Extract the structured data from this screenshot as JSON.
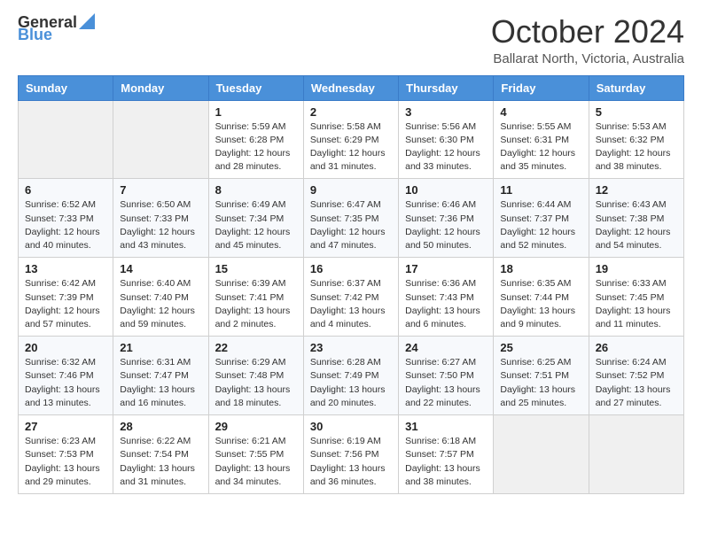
{
  "logo": {
    "general": "General",
    "blue": "Blue"
  },
  "title": "October 2024",
  "location": "Ballarat North, Victoria, Australia",
  "days_of_week": [
    "Sunday",
    "Monday",
    "Tuesday",
    "Wednesday",
    "Thursday",
    "Friday",
    "Saturday"
  ],
  "weeks": [
    [
      {
        "day": "",
        "info": ""
      },
      {
        "day": "",
        "info": ""
      },
      {
        "day": "1",
        "info": "Sunrise: 5:59 AM\nSunset: 6:28 PM\nDaylight: 12 hours\nand 28 minutes."
      },
      {
        "day": "2",
        "info": "Sunrise: 5:58 AM\nSunset: 6:29 PM\nDaylight: 12 hours\nand 31 minutes."
      },
      {
        "day": "3",
        "info": "Sunrise: 5:56 AM\nSunset: 6:30 PM\nDaylight: 12 hours\nand 33 minutes."
      },
      {
        "day": "4",
        "info": "Sunrise: 5:55 AM\nSunset: 6:31 PM\nDaylight: 12 hours\nand 35 minutes."
      },
      {
        "day": "5",
        "info": "Sunrise: 5:53 AM\nSunset: 6:32 PM\nDaylight: 12 hours\nand 38 minutes."
      }
    ],
    [
      {
        "day": "6",
        "info": "Sunrise: 6:52 AM\nSunset: 7:33 PM\nDaylight: 12 hours\nand 40 minutes."
      },
      {
        "day": "7",
        "info": "Sunrise: 6:50 AM\nSunset: 7:33 PM\nDaylight: 12 hours\nand 43 minutes."
      },
      {
        "day": "8",
        "info": "Sunrise: 6:49 AM\nSunset: 7:34 PM\nDaylight: 12 hours\nand 45 minutes."
      },
      {
        "day": "9",
        "info": "Sunrise: 6:47 AM\nSunset: 7:35 PM\nDaylight: 12 hours\nand 47 minutes."
      },
      {
        "day": "10",
        "info": "Sunrise: 6:46 AM\nSunset: 7:36 PM\nDaylight: 12 hours\nand 50 minutes."
      },
      {
        "day": "11",
        "info": "Sunrise: 6:44 AM\nSunset: 7:37 PM\nDaylight: 12 hours\nand 52 minutes."
      },
      {
        "day": "12",
        "info": "Sunrise: 6:43 AM\nSunset: 7:38 PM\nDaylight: 12 hours\nand 54 minutes."
      }
    ],
    [
      {
        "day": "13",
        "info": "Sunrise: 6:42 AM\nSunset: 7:39 PM\nDaylight: 12 hours\nand 57 minutes."
      },
      {
        "day": "14",
        "info": "Sunrise: 6:40 AM\nSunset: 7:40 PM\nDaylight: 12 hours\nand 59 minutes."
      },
      {
        "day": "15",
        "info": "Sunrise: 6:39 AM\nSunset: 7:41 PM\nDaylight: 13 hours\nand 2 minutes."
      },
      {
        "day": "16",
        "info": "Sunrise: 6:37 AM\nSunset: 7:42 PM\nDaylight: 13 hours\nand 4 minutes."
      },
      {
        "day": "17",
        "info": "Sunrise: 6:36 AM\nSunset: 7:43 PM\nDaylight: 13 hours\nand 6 minutes."
      },
      {
        "day": "18",
        "info": "Sunrise: 6:35 AM\nSunset: 7:44 PM\nDaylight: 13 hours\nand 9 minutes."
      },
      {
        "day": "19",
        "info": "Sunrise: 6:33 AM\nSunset: 7:45 PM\nDaylight: 13 hours\nand 11 minutes."
      }
    ],
    [
      {
        "day": "20",
        "info": "Sunrise: 6:32 AM\nSunset: 7:46 PM\nDaylight: 13 hours\nand 13 minutes."
      },
      {
        "day": "21",
        "info": "Sunrise: 6:31 AM\nSunset: 7:47 PM\nDaylight: 13 hours\nand 16 minutes."
      },
      {
        "day": "22",
        "info": "Sunrise: 6:29 AM\nSunset: 7:48 PM\nDaylight: 13 hours\nand 18 minutes."
      },
      {
        "day": "23",
        "info": "Sunrise: 6:28 AM\nSunset: 7:49 PM\nDaylight: 13 hours\nand 20 minutes."
      },
      {
        "day": "24",
        "info": "Sunrise: 6:27 AM\nSunset: 7:50 PM\nDaylight: 13 hours\nand 22 minutes."
      },
      {
        "day": "25",
        "info": "Sunrise: 6:25 AM\nSunset: 7:51 PM\nDaylight: 13 hours\nand 25 minutes."
      },
      {
        "day": "26",
        "info": "Sunrise: 6:24 AM\nSunset: 7:52 PM\nDaylight: 13 hours\nand 27 minutes."
      }
    ],
    [
      {
        "day": "27",
        "info": "Sunrise: 6:23 AM\nSunset: 7:53 PM\nDaylight: 13 hours\nand 29 minutes."
      },
      {
        "day": "28",
        "info": "Sunrise: 6:22 AM\nSunset: 7:54 PM\nDaylight: 13 hours\nand 31 minutes."
      },
      {
        "day": "29",
        "info": "Sunrise: 6:21 AM\nSunset: 7:55 PM\nDaylight: 13 hours\nand 34 minutes."
      },
      {
        "day": "30",
        "info": "Sunrise: 6:19 AM\nSunset: 7:56 PM\nDaylight: 13 hours\nand 36 minutes."
      },
      {
        "day": "31",
        "info": "Sunrise: 6:18 AM\nSunset: 7:57 PM\nDaylight: 13 hours\nand 38 minutes."
      },
      {
        "day": "",
        "info": ""
      },
      {
        "day": "",
        "info": ""
      }
    ]
  ]
}
